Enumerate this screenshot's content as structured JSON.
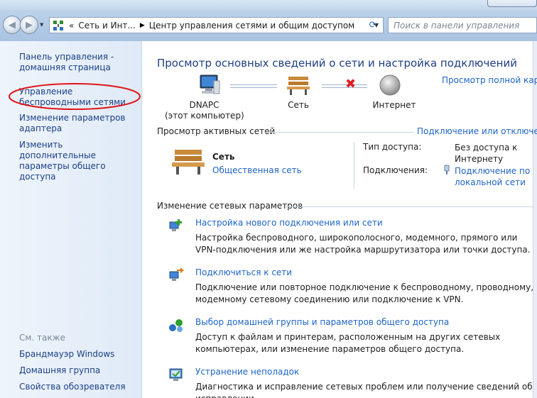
{
  "address_bar": {
    "prefix": "«",
    "segment1": "Сеть и Инт...",
    "segment2": "Центр управления сетями и общим доступом",
    "search_placeholder": "Поиск в панели управления"
  },
  "sidebar": {
    "home_link": "Панель управления - домашняя страница",
    "wireless_link": "Управление беспроводными сетями",
    "adapter_link": "Изменение параметров адаптера",
    "sharing_link": "Изменить дополнительные параметры общего доступа",
    "see_also": "См. также",
    "firewall": "Брандмауэр Windows",
    "homegroup": "Домашняя группа",
    "browser_props": "Свойства обозревателя"
  },
  "main": {
    "title": "Просмотр основных сведений о сети и настройка подключений",
    "full_map": "Просмотр полной карты",
    "map": {
      "computer_name": "DNAPC",
      "computer_sub": "(этот компьютер)",
      "network": "Сеть",
      "internet": "Интернет"
    },
    "active_networks": {
      "title": "Просмотр активных сетей",
      "connect_link": "Подключение или отключение",
      "network_name": "Сеть",
      "network_type": "Общественная сеть",
      "access_label": "Тип доступа:",
      "access_value": "Без доступа к Интернету",
      "connections_label": "Подключения:",
      "connections_value": "Подключение по локальной сети"
    },
    "change_settings": {
      "title": "Изменение сетевых параметров",
      "tasks": [
        {
          "link": "Настройка нового подключения или сети",
          "desc": "Настройка беспроводного, широкополосного, модемного, прямого или VPN-подключения или же настройка маршрутизатора или точки доступа."
        },
        {
          "link": "Подключиться к сети",
          "desc": "Подключение или повторное подключение к беспроводному, проводному, модемному сетевому соединению или подключение к VPN."
        },
        {
          "link": "Выбор домашней группы и параметров общего доступа",
          "desc": "Доступ к файлам и принтерам, расположенным на других сетевых компьютерах, или изменение параметров общего доступа."
        },
        {
          "link": "Устранение неполадок",
          "desc": "Диагностика и исправление сетевых проблем или получение сведений об исправлении."
        }
      ]
    }
  }
}
